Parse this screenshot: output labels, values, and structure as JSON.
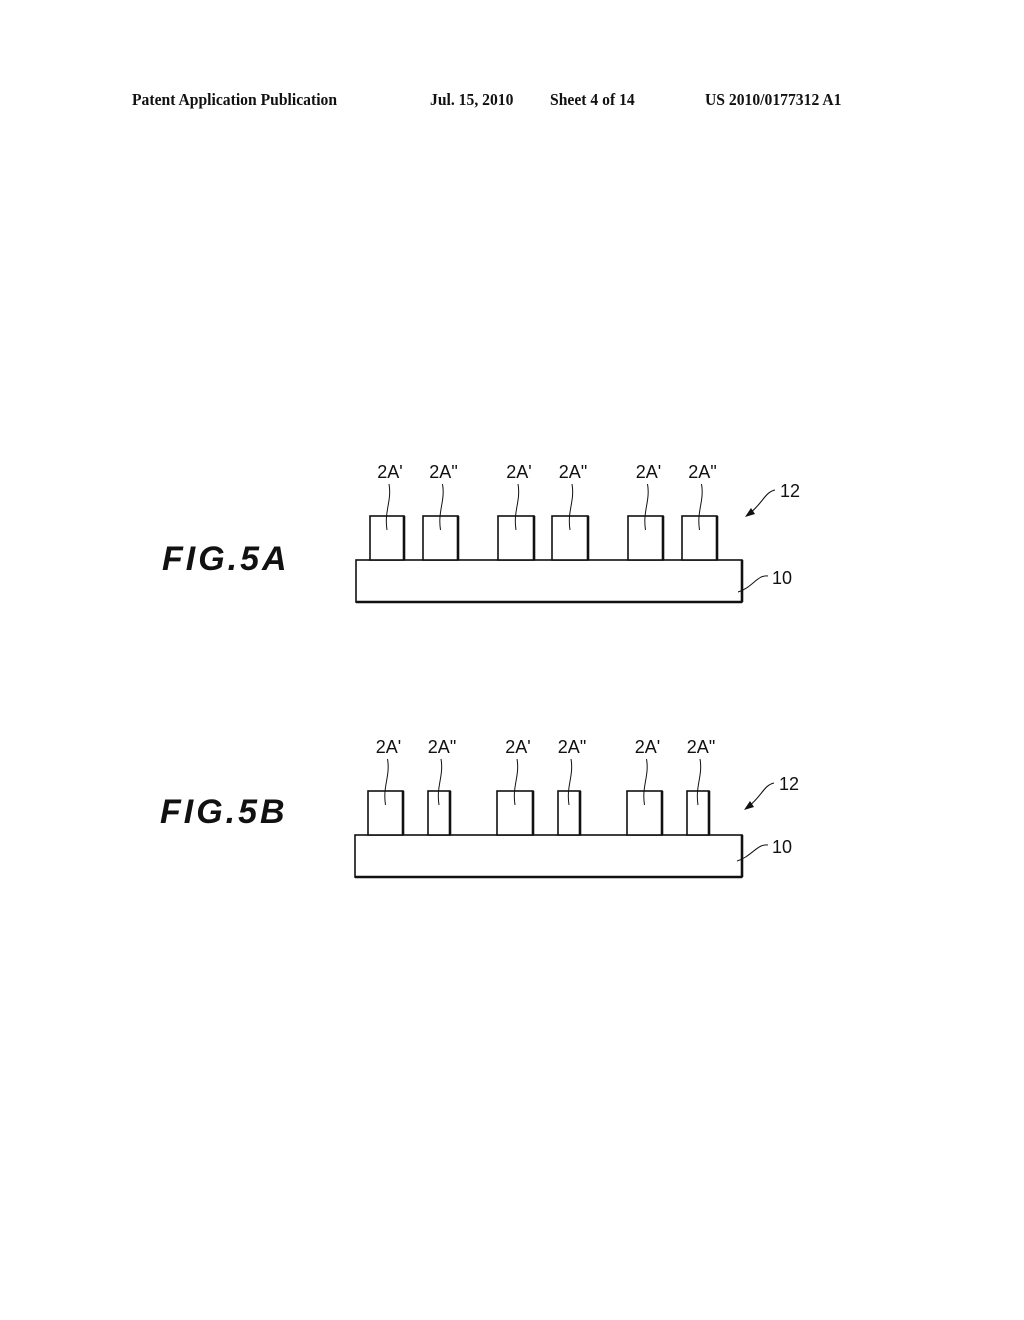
{
  "header": {
    "publication": "Patent Application Publication",
    "date": "Jul. 15, 2010",
    "sheet": "Sheet 4 of 14",
    "number": "US 2010/0177312 A1"
  },
  "figures": [
    {
      "id": "fig5a",
      "title": "FIG.5A",
      "assembly_ref": "12",
      "substrate_ref": "10",
      "features": [
        {
          "label": "2A'",
          "width": "wide"
        },
        {
          "label": "2A\"",
          "width": "wide"
        },
        {
          "label": "2A'",
          "width": "wide"
        },
        {
          "label": "2A\"",
          "width": "wide"
        },
        {
          "label": "2A'",
          "width": "wide"
        },
        {
          "label": "2A\"",
          "width": "wide"
        }
      ]
    },
    {
      "id": "fig5b",
      "title": "FIG.5B",
      "assembly_ref": "12",
      "substrate_ref": "10",
      "features": [
        {
          "label": "2A'",
          "width": "wide"
        },
        {
          "label": "2A\"",
          "width": "narrow"
        },
        {
          "label": "2A'",
          "width": "wide"
        },
        {
          "label": "2A\"",
          "width": "narrow"
        },
        {
          "label": "2A'",
          "width": "wide"
        },
        {
          "label": "2A\"",
          "width": "narrow"
        }
      ]
    }
  ]
}
